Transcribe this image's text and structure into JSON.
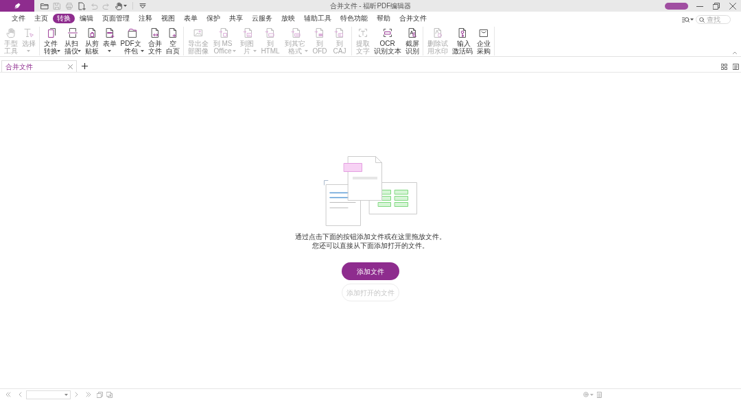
{
  "title_bar": {
    "title": "合并文件 - 福昕PDF编辑器",
    "quick_access": [
      {
        "disabled": false
      },
      {
        "disabled": true
      },
      {
        "disabled": true
      },
      {
        "disabled": false
      },
      {
        "disabled": true
      },
      {
        "disabled": true
      },
      {
        "disabled": false
      },
      {
        "disabled": false
      }
    ]
  },
  "menu": {
    "tabs": [
      {
        "label": "文件",
        "selected": false
      },
      {
        "label": "主页",
        "selected": false
      },
      {
        "label": "转换",
        "selected": true
      },
      {
        "label": "编辑",
        "selected": false
      },
      {
        "label": "页面管理",
        "selected": false
      },
      {
        "label": "注释",
        "selected": false
      },
      {
        "label": "视图",
        "selected": false
      },
      {
        "label": "表单",
        "selected": false
      },
      {
        "label": "保护",
        "selected": false
      },
      {
        "label": "共享",
        "selected": false
      },
      {
        "label": "云服务",
        "selected": false
      },
      {
        "label": "放映",
        "selected": false
      },
      {
        "label": "辅助工具",
        "selected": false
      },
      {
        "label": "特色功能",
        "selected": false
      },
      {
        "label": "帮助",
        "selected": false
      },
      {
        "label": "合并文件",
        "selected": false
      }
    ],
    "search": {
      "placeholder": "查找"
    }
  },
  "ribbon": {
    "groups": [
      {
        "buttons": [
          {
            "label": "手型工具",
            "dropdown": false,
            "disabled": true
          },
          {
            "label": "选择",
            "dropdown": true,
            "disabled": true
          }
        ]
      },
      {
        "buttons": [
          {
            "label": "文件转换",
            "dropdown": true,
            "disabled": false
          },
          {
            "label": "从扫描仪",
            "dropdown": true,
            "disabled": false
          },
          {
            "label": "从剪贴板",
            "dropdown": false,
            "disabled": false
          },
          {
            "label": "表单",
            "dropdown": true,
            "disabled": false
          },
          {
            "label": "PDF文件包",
            "dropdown": true,
            "disabled": false
          },
          {
            "label": "合并文件",
            "dropdown": false,
            "disabled": false
          },
          {
            "label": "空白页",
            "dropdown": false,
            "disabled": false
          }
        ]
      },
      {
        "buttons": [
          {
            "label": "导出全部图像",
            "dropdown": false,
            "disabled": true
          },
          {
            "label": "到 MS Office",
            "dropdown": true,
            "disabled": true
          },
          {
            "label": "到图片",
            "dropdown": true,
            "disabled": true
          },
          {
            "label": "到 HTML",
            "dropdown": false,
            "disabled": true
          },
          {
            "label": "到其它格式",
            "dropdown": true,
            "disabled": true
          },
          {
            "label": "到 OFD",
            "dropdown": false,
            "disabled": true
          },
          {
            "label": "到 CAJ",
            "dropdown": false,
            "disabled": true
          }
        ]
      },
      {
        "buttons": [
          {
            "label": "提取文字",
            "dropdown": false,
            "disabled": true
          },
          {
            "label": "OCR 识别文本",
            "dropdown": false,
            "disabled": false
          },
          {
            "label": "截屏识别",
            "dropdown": false,
            "disabled": false
          }
        ]
      },
      {
        "buttons": [
          {
            "label": "删除试用水印",
            "dropdown": false,
            "disabled": true
          },
          {
            "label": "输入激活码",
            "dropdown": false,
            "disabled": false
          },
          {
            "label": "企业采购",
            "dropdown": false,
            "disabled": false
          }
        ]
      }
    ]
  },
  "document_tabs": [
    {
      "label": "合并文件",
      "selected": true
    }
  ],
  "merge_panel": {
    "hint_lines": [
      "通过点击下面的按钮添加文件或在这里拖放文件。",
      "您还可以直接从下面添加打开的文件。"
    ],
    "buttons": [
      {
        "label": "添加文件",
        "disabled": false
      },
      {
        "label": "添加打开的文件",
        "disabled": true
      }
    ]
  }
}
